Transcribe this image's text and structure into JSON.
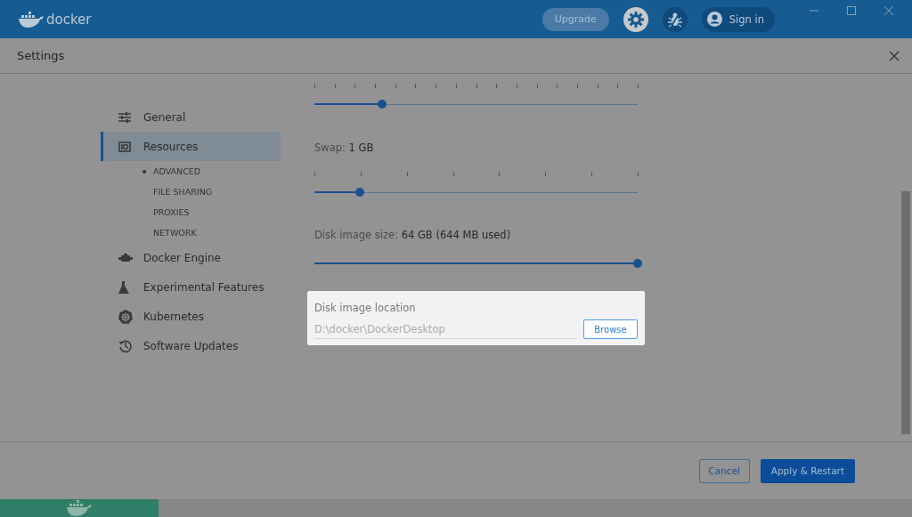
{
  "titlebar": {
    "logo_text": "docker",
    "upgrade_button": "Upgrade",
    "sign_in_button": "Sign in"
  },
  "settings": {
    "title": "Settings"
  },
  "sidebar": {
    "items": [
      {
        "label": "General",
        "selected": false
      },
      {
        "label": "Resources",
        "selected": true,
        "children": [
          {
            "label": "ADVANCED",
            "selected": true
          },
          {
            "label": "FILE SHARING",
            "selected": false
          },
          {
            "label": "PROXIES",
            "selected": false
          },
          {
            "label": "NETWORK",
            "selected": false
          }
        ]
      },
      {
        "label": "Docker Engine",
        "selected": false
      },
      {
        "label": "Experimental Features",
        "selected": false
      },
      {
        "label": "Kubernetes",
        "selected": false
      },
      {
        "label": "Software Updates",
        "selected": false
      }
    ]
  },
  "sliders": [
    {
      "kind": "ticked",
      "level": 0.21
    },
    {
      "kind": "ticked",
      "label": "Swap:",
      "value": "1 GB",
      "level": 0.14
    },
    {
      "kind": "plain",
      "label": "Disk image size:",
      "value": "64 GB (644 MB used)",
      "level": 1.0
    }
  ],
  "disk_location": {
    "label": "Disk image location",
    "value": "D:\\docker\\DockerDesktop",
    "button": "Browse"
  },
  "footer": {
    "cancel_button": "Cancel",
    "apply_button": "Apply & Restart"
  }
}
